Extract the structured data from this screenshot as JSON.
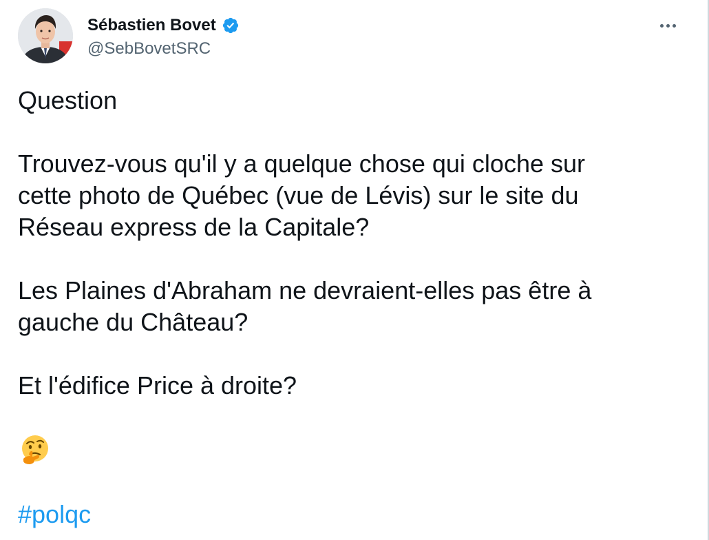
{
  "author": {
    "display_name": "Sébastien Bovet",
    "handle": "@SebBovetSRC",
    "verified_icon": "verified-badge-icon",
    "avatar_icon": "avatar-photo"
  },
  "menu": {
    "icon": "more-horizontal-icon"
  },
  "tweet": {
    "lines": [
      "Question",
      "Trouvez-vous qu'il y a quelque chose qui cloche sur",
      "cette photo de Québec (vue de Lévis) sur le site du",
      "Réseau express de la Capitale?",
      "Les Plaines d'Abraham ne devraient-elles pas être à",
      "gauche du Château?",
      "Et l'édifice Price à droite?"
    ],
    "emoji": "thinking-face-icon",
    "hashtag": "#polqc"
  },
  "colors": {
    "text": "#0f1419",
    "secondary": "#536471",
    "link": "#1d9bf0",
    "verified": "#1d9bf0"
  }
}
